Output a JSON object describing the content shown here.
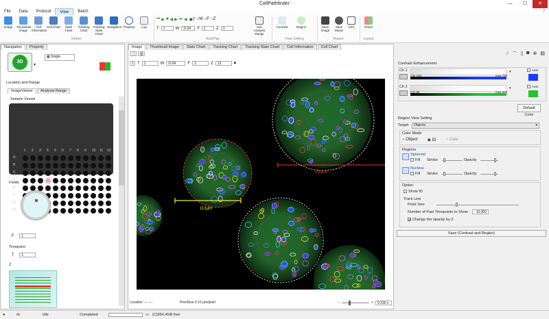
{
  "app": {
    "title": "CellPathfinder"
  },
  "menu": [
    "File",
    "Data",
    "Protocol",
    "View",
    "Batch"
  ],
  "menu_active": "View",
  "ribbon": {
    "viewer_buttons": [
      "Image",
      "Thumbnail Image",
      "Cell Information",
      "Cell Chart",
      "Stats Chart",
      "Tracking Chart",
      "Tracking Stats Chart",
      "Navigation",
      "Property",
      "Log"
    ],
    "viewer_group": "Viewer",
    "autoplay": {
      "t_value": "1",
      "w_value": "D-04",
      "f_value": "1",
      "z_value": "1",
      "time_label": "T",
      "w_label": "W",
      "f_label": "F",
      "z_label": "Z",
      "radio_t": "T",
      "radio_w": "W",
      "radio_f": "F",
      "radio_z": "Z",
      "use_analysis_range": "Use Analysis Range",
      "group": "AutoPlay"
    },
    "view_setting": {
      "contrast": "Contrast",
      "region": "Region",
      "group": "View Setting"
    },
    "report": {
      "save_image": "Save Image",
      "save_movie": "Save Movie",
      "csv": "CSV",
      "group": "Report"
    },
    "layout": {
      "panel": "Panel",
      "group": "Layout"
    }
  },
  "left": {
    "tabs": [
      "Navigation",
      "Property"
    ],
    "view_mode": "3D",
    "display_select": "Single",
    "location_range_title": "Location and Range",
    "sub_tabs": [
      "ImageViewer",
      "Analysis Range"
    ],
    "sample_vessel_title": "Sample Vessel",
    "columns": [
      "1",
      "2",
      "3",
      "4",
      "5",
      "6",
      "7",
      "8",
      "9",
      "10",
      "11",
      "12"
    ],
    "rows": [
      "A",
      "B",
      "C",
      "D",
      "E",
      "F",
      "G",
      "H"
    ],
    "selected_well": "D-04",
    "fields_title": "Fields",
    "f_label": "F",
    "f_value": "1",
    "timepoint_title": "Timepoint",
    "t_label": "T",
    "t_value": "1",
    "z_title": "Z"
  },
  "center": {
    "tabs": [
      "Image",
      "Thumbnail Image",
      "Stats Chart",
      "Tracking Chart",
      "Tracking Stats Chart",
      "Cell Information",
      "Cell Chart"
    ],
    "toolbar": {
      "t_label": "T",
      "t_value": "1",
      "w_label": "W",
      "w_value": "D-04",
      "f_label": "F",
      "f_value": "1",
      "z_label": "Z",
      "z_value": "13"
    },
    "scale_labels": [
      "180μm",
      "113μm"
    ],
    "status": {
      "location": "Location ---, ---",
      "pixel_size": "PixelSize 0.16 μm/pixel",
      "zoom": "0.330 x"
    }
  },
  "right": {
    "contrast_title": "Contrast Enhancement",
    "channels": [
      {
        "name": "Ch 1",
        "min_label": "min",
        "min": "100",
        "max_label": "max",
        "max": "793",
        "auto": "Auto",
        "color": "#1a3cff"
      },
      {
        "name": "Ch 2",
        "min_label": "min",
        "min": "88",
        "max_label": "max",
        "max": "628",
        "auto": "Auto",
        "color": "#22c52a"
      }
    ],
    "default_color_button": "Default Color",
    "region_title": "Region View Setting",
    "target_label": "Target",
    "target_value": "Objects",
    "color_mode_title": "Color Mode",
    "color_modes": [
      "Object",
      "ID",
      "Gate"
    ],
    "regions_title": "Regions",
    "regions": [
      {
        "name": "Spheroid",
        "fill": "Fill",
        "stroke": "Stroke",
        "opacity": "Opacity"
      },
      {
        "name": "Nucleus",
        "fill": "Fill",
        "stroke": "Stroke",
        "opacity": "Opacity"
      }
    ],
    "option_title": "Option",
    "show_id": "Show ID",
    "track_line": "Track Line",
    "point_size": "Point Size",
    "past_timepoints_label": "Number of Past Timepoints to Show",
    "past_timepoints_value": "10,000",
    "change_opacity": "Change the opacity by Z",
    "save_button": "Save (Contrast and Region)"
  },
  "statusbar": {
    "user": "rb",
    "state": "Idle",
    "progress_text": "Completed",
    "disk": "(C)854.4GB free"
  }
}
